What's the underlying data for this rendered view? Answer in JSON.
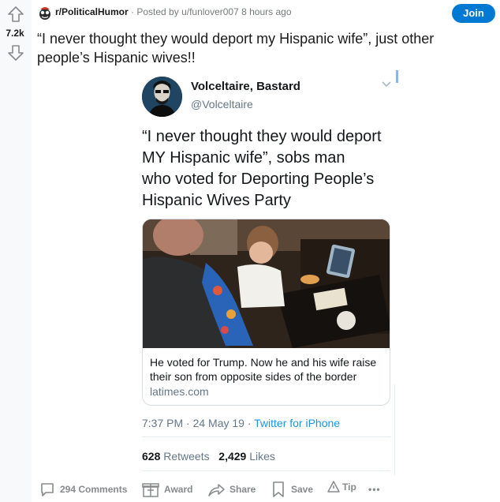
{
  "vote": {
    "count": "7.2k"
  },
  "post": {
    "subreddit": "r/PoliticalHumor",
    "posted_by": "· Posted by u/funlover007 8 hours ago",
    "join_label": "Join",
    "title": "“I never thought they would deport my Hispanic wife”, just other people’s Hispanic wives!!"
  },
  "tweet": {
    "name": "Volceltaire, Bastard",
    "handle": "@Volceltaire",
    "text_lines": [
      "“I never thought they would deport",
      "MY Hispanic wife”, sobs man",
      "who voted for Deporting People’s",
      "Hispanic Wives Party"
    ],
    "card": {
      "text": "He voted for Trump. Now he and his wife raise their son from opposite sides of the border",
      "domain": "latimes.com"
    },
    "time": "7:37 PM · 24 May 19 · ",
    "source": "Twitter for iPhone",
    "retweets_count": "628",
    "retweets_label": "Retweets",
    "likes_count": "2,429",
    "likes_label": "Likes"
  },
  "actions": {
    "comments": "294 Comments",
    "award": "Award",
    "share": "Share",
    "save": "Save",
    "tip": "Tip",
    "more": "•••"
  },
  "icons": [
    "upvote-icon",
    "downvote-icon",
    "chevron-down-icon",
    "comment-icon",
    "award-icon",
    "share-icon",
    "save-icon",
    "tip-icon",
    "more-icon"
  ],
  "colors": {
    "accent": "#0079d3",
    "twitter_link": "#1b95e0",
    "muted": "#878a8c"
  }
}
